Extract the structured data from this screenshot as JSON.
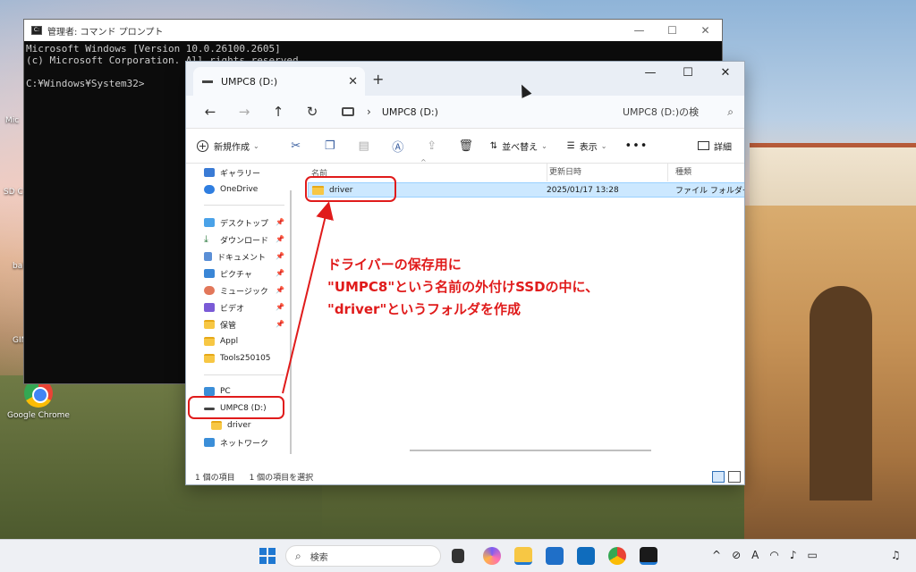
{
  "desktop": {
    "icons": [
      {
        "label": "Mic"
      },
      {
        "label": "SD Ca"
      },
      {
        "label": "bal"
      },
      {
        "label": "GIN"
      },
      {
        "label": "Google Chrome"
      }
    ]
  },
  "cmd": {
    "title": "管理者: コマンド プロンプト",
    "lines": [
      "Microsoft Windows [Version 10.0.26100.2605]",
      "(c) Microsoft Corporation. All rights reserved.",
      "",
      "C:¥Windows¥System32>"
    ],
    "minimize": "—",
    "maximize": "☐",
    "close": "✕"
  },
  "explorer": {
    "tab_title": "UMPC8 (D:)",
    "tab_close": "✕",
    "new_tab": "+",
    "minimize": "—",
    "maximize": "☐",
    "close": "✕",
    "breadcrumb": "UMPC8 (D:)",
    "search_placeholder": "UMPC8 (D:)の検",
    "toolbar": {
      "new": "新規作成",
      "sort": "並べ替え",
      "view": "表示",
      "more": "•••",
      "details": "詳細"
    },
    "nav": {
      "gallery": "ギャラリー",
      "onedrive": "OneDrive",
      "desktop": "デスクトップ",
      "downloads": "ダウンロード",
      "documents": "ドキュメント",
      "pictures": "ピクチャ",
      "music": "ミュージック",
      "videos": "ビデオ",
      "storage": "保管",
      "appl": "Appl",
      "tools": "Tools250105",
      "pc": "PC",
      "drive": "UMPC8 (D:)",
      "driver": "driver",
      "network": "ネットワーク"
    },
    "columns": {
      "name": "名前",
      "modified": "更新日時",
      "type": "種類"
    },
    "rows": [
      {
        "name": "driver",
        "modified": "2025/01/17 13:28",
        "type": "ファイル フォルダー"
      }
    ],
    "status_count": "1 個の項目",
    "status_selected": "1 個の項目を選択"
  },
  "annotation": {
    "text": "ドライバーの保存用に\n\"UMPC8\"という名前の外付けSSDの中に、\n\"driver\"というフォルダを作成",
    "color": "#e01b1b"
  },
  "taskbar": {
    "search_placeholder": "検索"
  }
}
